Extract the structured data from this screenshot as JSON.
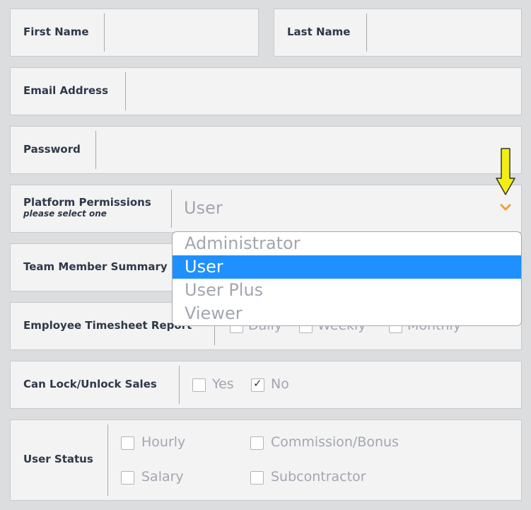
{
  "form": {
    "first_name_label": "First Name",
    "last_name_label": "Last Name",
    "email_label": "Email Address",
    "password_label": "Password",
    "permissions_label": "Platform Permissions",
    "permissions_hint": "please select one",
    "permissions_value": "User",
    "team_summary_label": "Team Member Summary",
    "timesheet_label": "Employee Timesheet Report",
    "timesheet_options": [
      "Daily",
      "Weekly",
      "Monthly"
    ],
    "lock_label": "Can Lock/Unlock Sales",
    "lock_options": [
      "Yes",
      "No"
    ],
    "lock_checked": "No",
    "status_label": "User Status",
    "status_options": [
      "Hourly",
      "Commission/Bonus",
      "Salary",
      "Subcontractor"
    ]
  },
  "dropdown": {
    "options": [
      "Administrator",
      "User",
      "User Plus",
      "Viewer"
    ],
    "selected": "User"
  },
  "colors": {
    "arrow": "#f2ee14",
    "chevron": "#f0a030",
    "selected_bg": "#1e90ff"
  },
  "icons": {
    "chevron": "chevron-down-icon",
    "arrow": "down-arrow-annotation-icon"
  }
}
